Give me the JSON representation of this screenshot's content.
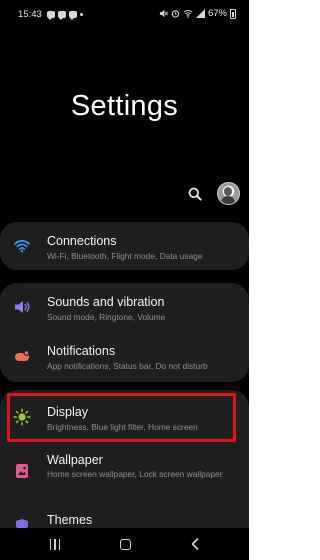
{
  "status_bar": {
    "time": "15:43",
    "battery_text": "67%",
    "left_icons": [
      "message-icon",
      "chat-icon",
      "chat-icon",
      "dot-icon"
    ],
    "right_icons": [
      "mute-icon",
      "alarm-icon",
      "wifi-icon",
      "signal-icon",
      "battery-icon"
    ]
  },
  "header": {
    "title": "Settings"
  },
  "toolbar": {
    "icons": [
      "search-icon",
      "avatar"
    ]
  },
  "settings": {
    "connections": {
      "title": "Connections",
      "subtitle": "Wi-Fi, Bluetooth, Flight mode, Data usage",
      "icon": "wifi-icon",
      "icon_color": "#3d8ff7"
    },
    "sounds": {
      "title": "Sounds and vibration",
      "subtitle": "Sound mode, Ringtone, Volume",
      "icon": "speaker-icon",
      "icon_color": "#8a7ee8"
    },
    "notifications": {
      "title": "Notifications",
      "subtitle": "App notifications, Status bar, Do not disturb",
      "icon": "notification-icon",
      "icon_color": "#f06d5c"
    },
    "display": {
      "title": "Display",
      "subtitle": "Brightness, Blue light filter, Home screen",
      "icon": "sun-icon",
      "icon_color": "#9ccc3d"
    },
    "wallpaper": {
      "title": "Wallpaper",
      "subtitle": "Home screen wallpaper, Lock screen wallpaper",
      "icon": "image-icon",
      "icon_color": "#e8578f"
    },
    "themes": {
      "title": "Themes",
      "icon": "themes-icon",
      "icon_color": "#7c6fe0"
    }
  },
  "highlight": {
    "target": "display",
    "color": "#e3111b"
  },
  "nav_bar": {
    "buttons": [
      "recent-apps-icon",
      "home-icon",
      "back-icon"
    ]
  },
  "colors": {
    "background": "#000000",
    "card": "#1f1f1f",
    "title_text": "#f2f2f2",
    "subtitle_text": "#8e8e8e"
  }
}
